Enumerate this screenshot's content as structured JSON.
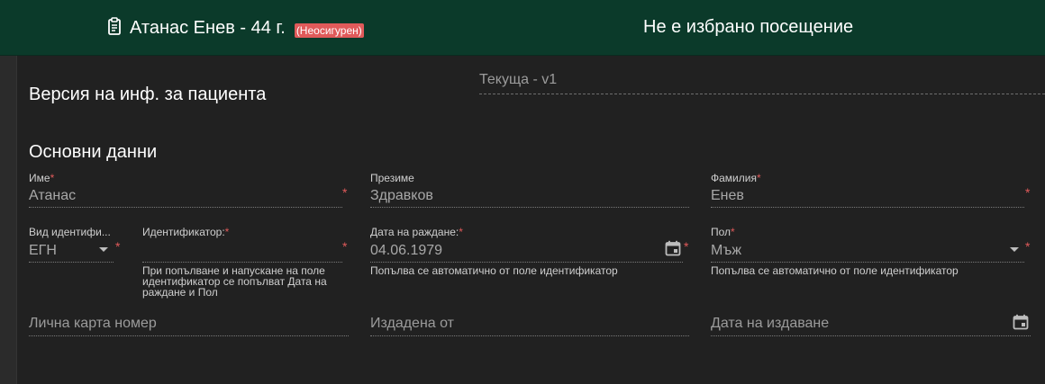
{
  "header": {
    "patient_name": "Атанас Енев - 44 г.",
    "insurance_badge": "(Неосигурен)",
    "visit_status": "Не е избрано посещение"
  },
  "version": {
    "label": "Версия на инф. за пациента",
    "value": "Текуща - v1"
  },
  "basic": {
    "heading": "Основни данни",
    "first_name": {
      "label": "Име",
      "value": "Атанас"
    },
    "middle_name": {
      "label": "Презиме",
      "value": "Здравков"
    },
    "last_name": {
      "label": "Фамилия",
      "value": "Енев"
    },
    "id_type": {
      "label": "Вид идентифи...",
      "value": "ЕГН"
    },
    "identifier": {
      "label": "Идентификатор:",
      "value": "",
      "hint": "При попълване и напускане на поле идентификатор се попълват Дата на раждане и Пол"
    },
    "birth_date": {
      "label": "Дата на раждане:",
      "value": "04.06.1979",
      "hint": "Попълва се автоматично от поле идентификатор"
    },
    "gender": {
      "label": "Пол",
      "value": "Мъж",
      "hint": "Попълва се автоматично от поле идентификатор"
    },
    "id_card_number": {
      "placeholder": "Лична карта номер"
    },
    "issued_by": {
      "placeholder": "Издадена от"
    },
    "issue_date": {
      "placeholder": "Дата на издаване"
    }
  },
  "required_mark": "*",
  "icons": {
    "patient": "clipboard-icon",
    "calendar": "calendar-icon",
    "dropdown": "caret-down-icon"
  },
  "colors": {
    "header_bg": "#0b3a2a",
    "page_bg": "#212121",
    "required": "#e05a5a"
  }
}
